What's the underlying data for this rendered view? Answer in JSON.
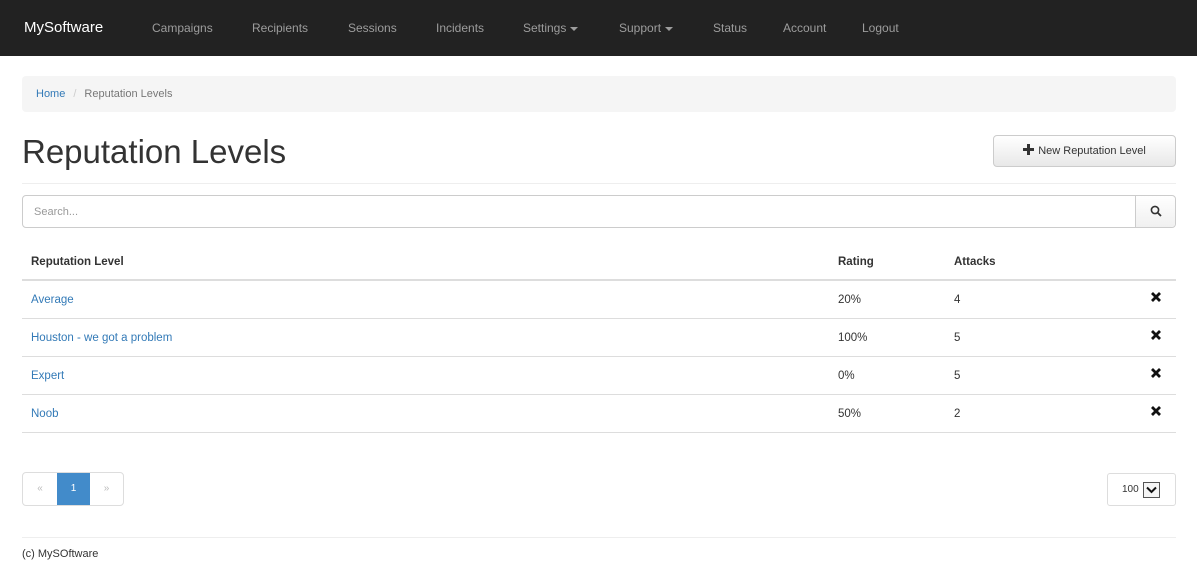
{
  "navbar": {
    "brand": "MySoftware",
    "items": [
      {
        "label": "Campaigns",
        "dropdown": false
      },
      {
        "label": "Recipients",
        "dropdown": false
      },
      {
        "label": "Sessions",
        "dropdown": false
      },
      {
        "label": "Incidents",
        "dropdown": false
      },
      {
        "label": "Settings",
        "dropdown": true
      },
      {
        "label": "Support",
        "dropdown": true
      },
      {
        "label": "Status",
        "dropdown": false
      },
      {
        "label": "Account",
        "dropdown": false
      },
      {
        "label": "Logout",
        "dropdown": false
      }
    ]
  },
  "breadcrumb": {
    "home": "Home",
    "separator": "/",
    "current": "Reputation Levels"
  },
  "header": {
    "title": "Reputation Levels",
    "new_button_label": "New Reputation Level"
  },
  "search": {
    "placeholder": "Search...",
    "value": ""
  },
  "table": {
    "columns": [
      "Reputation Level",
      "Rating",
      "Attacks"
    ],
    "rows": [
      {
        "name": "Average",
        "rating": "20%",
        "attacks": "4"
      },
      {
        "name": "Houston - we got a problem",
        "rating": "100%",
        "attacks": "5"
      },
      {
        "name": "Expert",
        "rating": "0%",
        "attacks": "5"
      },
      {
        "name": "Noob",
        "rating": "50%",
        "attacks": "2"
      }
    ]
  },
  "pagination": {
    "prev": "«",
    "current_page": "1",
    "next": "»"
  },
  "per_page": {
    "value": "100"
  },
  "footer": {
    "text": "(c) MySOftware"
  },
  "colors": {
    "navbar_bg": "#222222",
    "link": "#337ab7",
    "active_page": "#428bca"
  }
}
